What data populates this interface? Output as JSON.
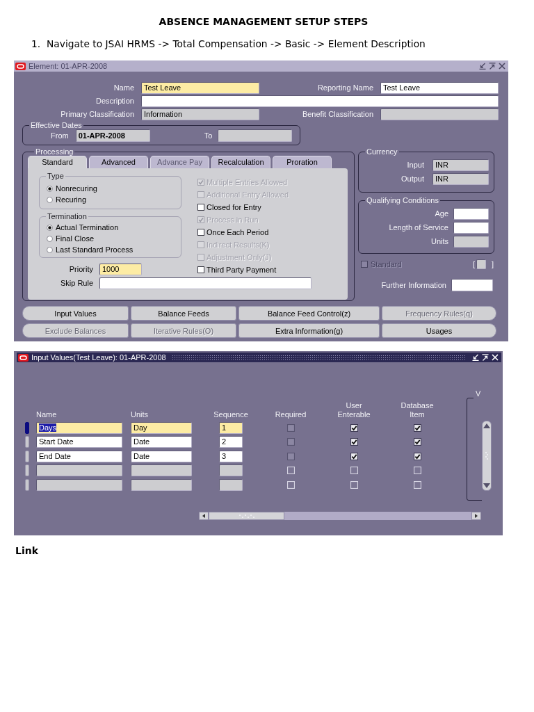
{
  "heading": "ABSENCE MANAGEMENT SETUP STEPS",
  "steps": [
    {
      "number": "1.",
      "text": "Navigate to JSAI HRMS -> Total Compensation -> Basic -> Element Description"
    }
  ],
  "element_window": {
    "title": "Element: 01-APR-2008",
    "active": false,
    "header_rows": [
      {
        "fields": [
          {
            "label": "Name",
            "value": "Test Leave",
            "kind": "required"
          },
          {
            "label": "Reporting Name",
            "value": "Test Leave",
            "kind": "editable"
          }
        ]
      },
      {
        "fields": [
          {
            "label": "Description",
            "kind": "editable"
          }
        ]
      },
      {
        "fields": [
          {
            "label": "Primary Classification",
            "value": "Information",
            "kind": "readonly"
          },
          {
            "label": "Benefit Classification",
            "kind": "readonly"
          }
        ]
      }
    ],
    "effective_dates": {
      "title": "Effective Dates",
      "from": {
        "label": "From",
        "value": "01-APR-2008",
        "kind": "readonly"
      },
      "to": {
        "label": "To",
        "kind": "readonly"
      }
    },
    "processing": {
      "title": "Processing",
      "tabs": [
        {
          "label": "Standard",
          "selected": true,
          "disabled": false
        },
        {
          "label": "Advanced",
          "selected": false,
          "disabled": false
        },
        {
          "label": "Advance Pay",
          "selected": false,
          "disabled": true
        },
        {
          "label": "Recalculation",
          "selected": false,
          "disabled": false
        },
        {
          "label": "Proration",
          "selected": false,
          "disabled": false
        }
      ],
      "type": {
        "title": "Type",
        "options": [
          {
            "label": "Nonrecuring",
            "selected": true
          },
          {
            "label": "Recuring",
            "selected": false
          }
        ]
      },
      "termination": {
        "title": "Termination",
        "options": [
          {
            "label": "Actual Termination",
            "selected": true
          },
          {
            "label": "Final Close",
            "selected": false
          },
          {
            "label": "Last Standard Process",
            "selected": false
          }
        ]
      },
      "priority": {
        "label": "Priority",
        "value": "1000",
        "kind": "required"
      },
      "skip_rule": {
        "label": "Skip Rule",
        "kind": "editable"
      },
      "checkboxes": [
        {
          "label": "Multiple Entries Allowed",
          "checked": true,
          "disabled": true
        },
        {
          "label": "Additional Entry Allowed",
          "checked": false,
          "disabled": true
        },
        {
          "label": "Closed for Entry",
          "checked": false,
          "disabled": false
        },
        {
          "label": "Process in Run",
          "checked": true,
          "disabled": true
        },
        {
          "label": "Once Each Period",
          "checked": false,
          "disabled": false
        },
        {
          "label": "Indirect Results(K)",
          "checked": false,
          "disabled": true
        },
        {
          "label": "Adjustment Only(J)",
          "checked": false,
          "disabled": true
        },
        {
          "label": "Third Party Payment",
          "checked": false,
          "disabled": false
        }
      ]
    },
    "currency": {
      "title": "Currency",
      "fields": [
        {
          "label": "Input",
          "value": "INR",
          "kind": "readonly"
        },
        {
          "label": "Output",
          "value": "INR",
          "kind": "readonly"
        }
      ]
    },
    "qualifying_conditions": {
      "title": "Qualifying Conditions",
      "fields": [
        {
          "label": "Age",
          "kind": "editable"
        },
        {
          "label": "Length of Service",
          "kind": "editable"
        },
        {
          "label": "Units",
          "kind": "readonly"
        }
      ]
    },
    "standard": {
      "label": "Standard",
      "checked": false,
      "disabled": true
    },
    "flexfield": {
      "open": "[",
      "close": "]",
      "kind": "readonly"
    },
    "further_information": {
      "label": "Further Information",
      "kind": "editable"
    },
    "buttons": [
      {
        "label": "Input Values",
        "disabled": false
      },
      {
        "label": "Balance Feeds",
        "disabled": false
      },
      {
        "label": "Balance Feed Control(z)",
        "disabled": false
      },
      {
        "label": "Frequency Rules(q)",
        "disabled": true
      },
      {
        "label": "Exclude Balances",
        "disabled": true
      },
      {
        "label": "Iterative Rules(O)",
        "disabled": true
      },
      {
        "label": "Extra Information(g)",
        "disabled": false
      },
      {
        "label": "Usages",
        "disabled": false
      }
    ]
  },
  "input_values_window": {
    "title": "Input Values(Test Leave): 01-APR-2008",
    "active": true,
    "columns": [
      {
        "label": "Name",
        "kind": "text"
      },
      {
        "label": "Units",
        "kind": "text"
      },
      {
        "label": "Sequence",
        "kind": "text"
      },
      {
        "label": "Required",
        "kind": "checkbox",
        "disabled": true
      },
      {
        "label": "User Enterable",
        "kind": "checkbox",
        "disabled": false
      },
      {
        "label": "Database Item",
        "kind": "checkbox",
        "disabled": false
      }
    ],
    "region_label": "V",
    "rows": [
      {
        "kind": "record",
        "selected": true,
        "name": "Days",
        "units": "Day",
        "sequence": "1",
        "required": false,
        "user_enterable": true,
        "database_item": true
      },
      {
        "kind": "record",
        "selected": false,
        "name": "Start Date",
        "units": "Date",
        "sequence": "2",
        "required": false,
        "user_enterable": true,
        "database_item": true
      },
      {
        "kind": "record",
        "selected": false,
        "name": "End Date",
        "units": "Date",
        "sequence": "3",
        "required": false,
        "user_enterable": true,
        "database_item": true
      },
      {
        "kind": "blank",
        "selected": false,
        "required": false,
        "user_enterable": false,
        "database_item": false
      },
      {
        "kind": "blank",
        "selected": false,
        "required": false,
        "user_enterable": false,
        "database_item": false
      }
    ]
  },
  "footer": "Link"
}
